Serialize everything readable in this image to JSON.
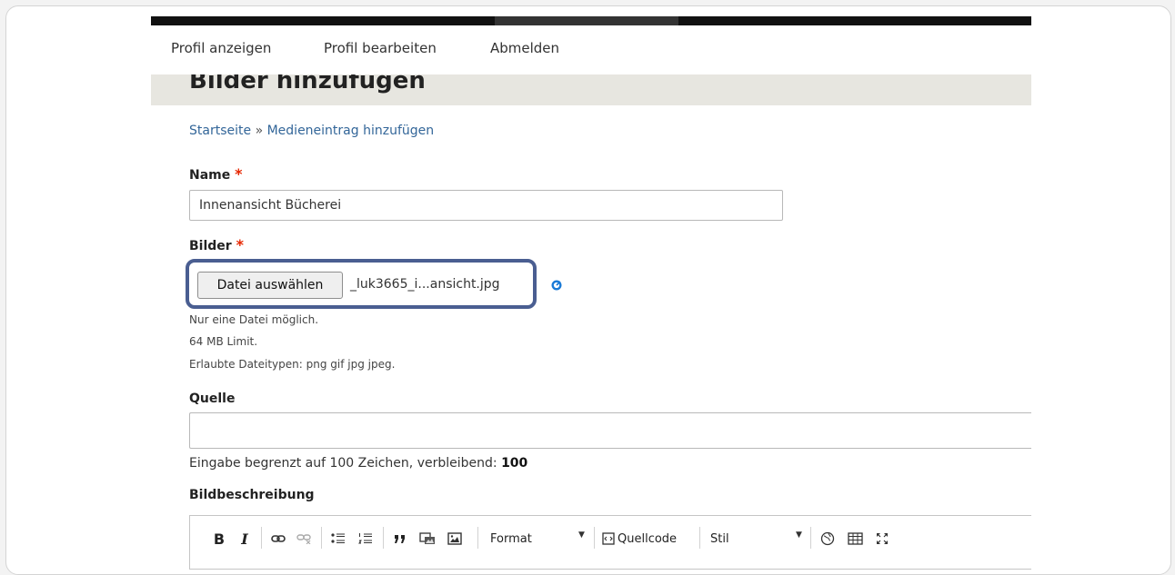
{
  "nav": {
    "view_profile": "Profil anzeigen",
    "edit_profile": "Profil bearbeiten",
    "logout": "Abmelden"
  },
  "page": {
    "title": "Bilder hinzufügen"
  },
  "breadcrumb": {
    "home": "Startseite",
    "separator": "»",
    "current": "Medieneintrag hinzufügen"
  },
  "form": {
    "required_marker": "*",
    "name": {
      "label": "Name",
      "value": "Innenansicht Bücherei"
    },
    "images": {
      "label": "Bilder",
      "button_label": "Datei auswählen",
      "file_name": "_luk3665_i...ansicht.jpg",
      "help_one_file": "Nur eine Datei möglich.",
      "help_limit": "64 MB Limit.",
      "help_types": "Erlaubte Dateitypen: png gif jpg jpeg."
    },
    "source": {
      "label": "Quelle",
      "value": "",
      "counter_text": "Eingabe begrenzt auf 100 Zeichen, verbleibend: ",
      "counter_value": "100"
    },
    "description": {
      "label": "Bildbeschreibung"
    }
  },
  "editor_toolbar": {
    "bold": "B",
    "italic": "I",
    "format_label": "Format",
    "source_label": "Quellcode",
    "style_label": "Stil"
  },
  "colors": {
    "highlight_border": "#4a5e91",
    "link": "#336699",
    "required": "#e62600",
    "title_band": "#e7e6e0",
    "top_bar": "#111111"
  }
}
